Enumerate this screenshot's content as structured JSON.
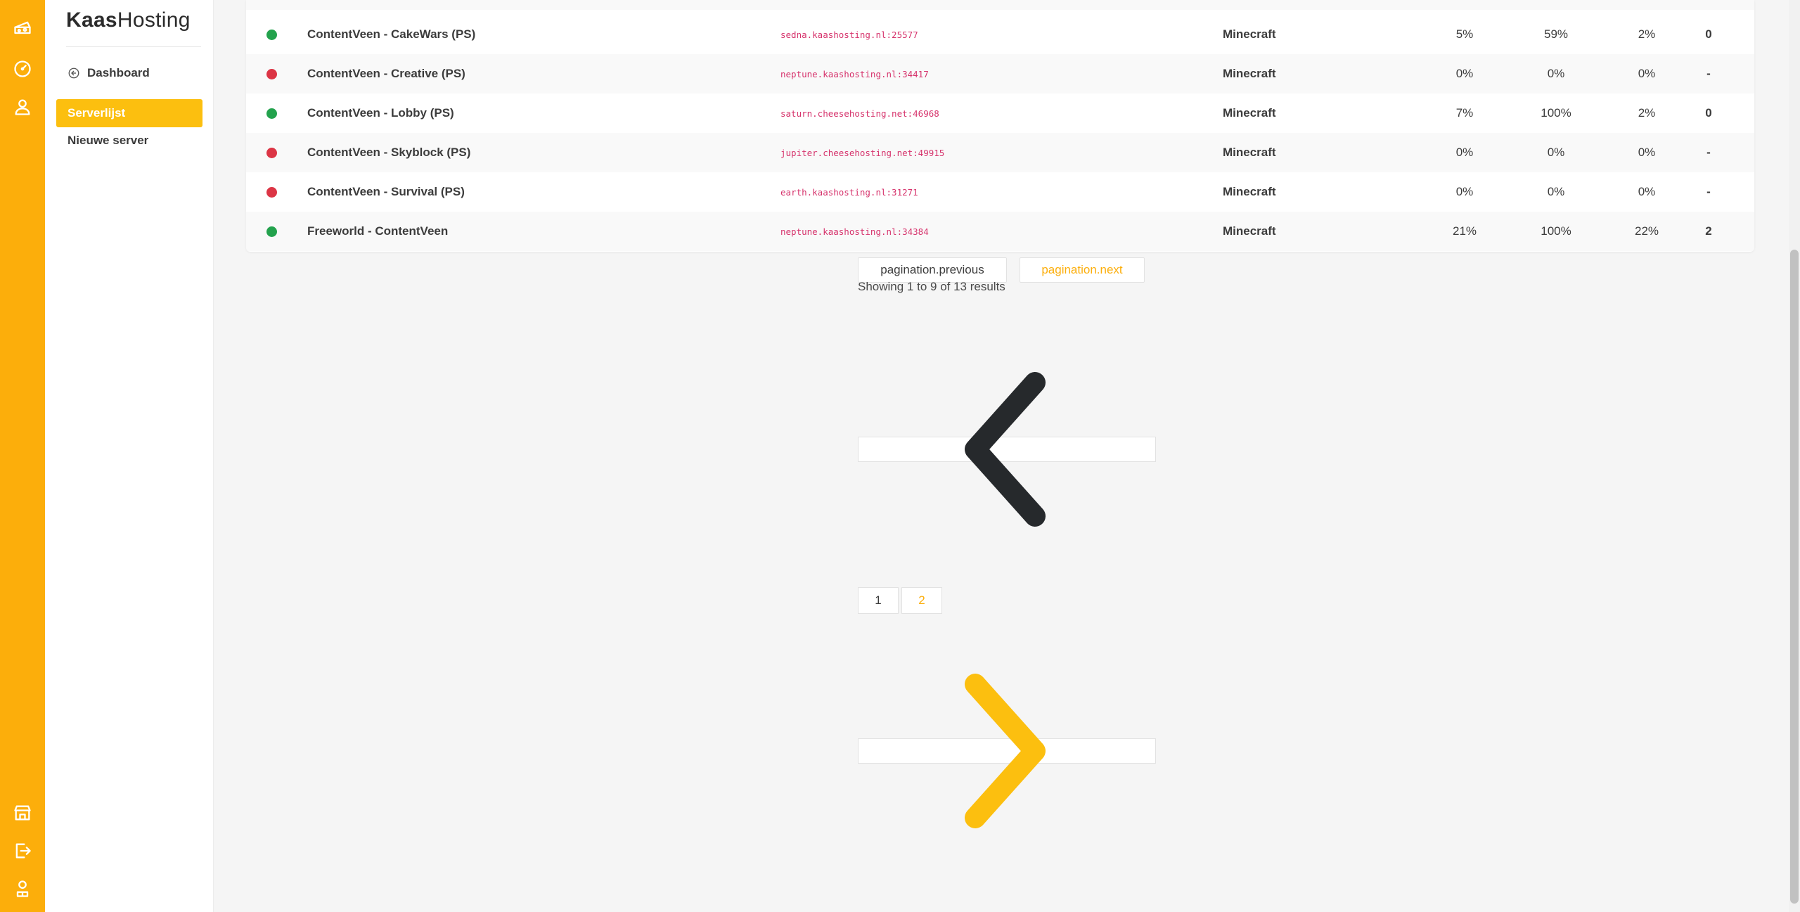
{
  "rail": {
    "icons": [
      "cheese-icon",
      "dashboard-gauge-icon",
      "user-icon",
      "store-icon",
      "logout-icon",
      "profile-icon"
    ]
  },
  "sidebar": {
    "brand_bold": "Kaas",
    "brand_light": "Hosting",
    "back_label": "Dashboard",
    "items": [
      {
        "label": "Serverlijst",
        "active": true
      },
      {
        "label": "Nieuwe server",
        "active": false
      }
    ]
  },
  "servers": [
    {
      "name": "ContentVeen - CakeWars (PS)",
      "address": "sedna.kaashosting.nl:25577",
      "game": "Minecraft",
      "cpu": "5%",
      "ram": "59%",
      "disk": "2%",
      "players": "0",
      "status": "online"
    },
    {
      "name": "ContentVeen - Creative (PS)",
      "address": "neptune.kaashosting.nl:34417",
      "game": "Minecraft",
      "cpu": "0%",
      "ram": "0%",
      "disk": "0%",
      "players": "-",
      "status": "offline"
    },
    {
      "name": "ContentVeen - Lobby (PS)",
      "address": "saturn.cheesehosting.net:46968",
      "game": "Minecraft",
      "cpu": "7%",
      "ram": "100%",
      "disk": "2%",
      "players": "0",
      "status": "online"
    },
    {
      "name": "ContentVeen - Skyblock (PS)",
      "address": "jupiter.cheesehosting.net:49915",
      "game": "Minecraft",
      "cpu": "0%",
      "ram": "0%",
      "disk": "0%",
      "players": "-",
      "status": "offline"
    },
    {
      "name": "ContentVeen - Survival (PS)",
      "address": "earth.kaashosting.nl:31271",
      "game": "Minecraft",
      "cpu": "0%",
      "ram": "0%",
      "disk": "0%",
      "players": "-",
      "status": "offline"
    },
    {
      "name": "Freeworld - ContentVeen",
      "address": "neptune.kaashosting.nl:34384",
      "game": "Minecraft",
      "cpu": "21%",
      "ram": "100%",
      "disk": "22%",
      "players": "2",
      "status": "online"
    }
  ],
  "pagination": {
    "previous_label": "pagination.previous",
    "next_label": "pagination.next",
    "summary": "Showing 1 to 9 of 13 results",
    "pages": [
      "1",
      "2"
    ],
    "current_page": "2"
  },
  "colors": {
    "brand": "#fcae0b",
    "active": "#fcbf0f",
    "online": "#23a24d",
    "offline": "#dc3545",
    "address": "#d6336c"
  }
}
